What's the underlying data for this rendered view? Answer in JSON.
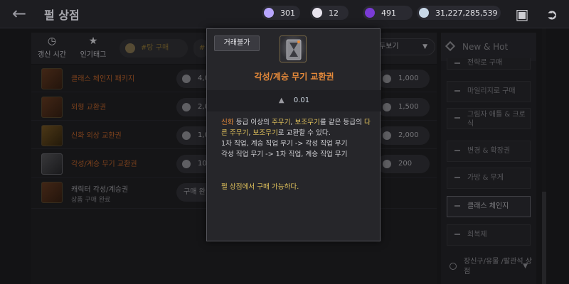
{
  "header": {
    "title": "펄 상점",
    "currencies": [
      {
        "icon": "purple-crystal-icon",
        "value": "301",
        "color": "#b8a6ff"
      },
      {
        "icon": "pearl-icon",
        "value": "12",
        "color": "#e8e4ee"
      },
      {
        "icon": "dark-orb-icon",
        "value": "491",
        "color": "#7a3bd6"
      },
      {
        "icon": "silver-coin-icon",
        "value": "31,227,285,539",
        "color": "#c8d8e8"
      }
    ]
  },
  "filters": {
    "tabs": [
      {
        "icon": "clock-icon",
        "label": "갱신 시간"
      },
      {
        "icon": "star-icon",
        "label": "인기태그"
      }
    ],
    "pill_label": "#탕 구매",
    "pill_prefix": "#",
    "dropdown_label": "두보기"
  },
  "items": [
    {
      "name": "클래스 체인지 패키지",
      "price1": "4,0",
      "price2": "1,000"
    },
    {
      "name": "외형 교환권",
      "price1": "2,0",
      "price2": "1,500"
    },
    {
      "name": "신화 외상 교환권",
      "price1": "1,0",
      "price2": "2,000"
    },
    {
      "name": "각성/계승 무기 교환권",
      "price1": "10",
      "price2": "200"
    },
    {
      "name": "캐릭터 각성/계승권",
      "sub": "상품 구매 완료",
      "buy": "구매 완"
    }
  ],
  "right_panel": {
    "header": "New & Hot",
    "items": [
      {
        "label": "전략로 구매"
      },
      {
        "label": "마일리지로 구매"
      },
      {
        "label": "그림자 애틀 & 크로식"
      },
      {
        "label": "변경 & 확장권"
      },
      {
        "label": "가방 & 무게"
      },
      {
        "label": "클래스 체인지"
      },
      {
        "label": "회복제"
      }
    ],
    "footer": "장신구/유물 /팔관석 상점"
  },
  "popup": {
    "badge": "거래불가",
    "title": "각성/계승 무기 교환권",
    "weight": "0.01",
    "desc": {
      "p1": "신화",
      "p2": " 등급 이상의 ",
      "p3": "주무기",
      "p4": ", ",
      "p5": "보조무기",
      "p6": "를 같은 등급의 ",
      "p7": "다른 주무기",
      "p8": ", ",
      "p9": "보조무기",
      "p10": "로 교환할 수 있다.",
      "line2": "1차 직업, 계승 직업 무기 -> 각성 직업 무기",
      "line3": "각성 직업 무기 -> 1차 직업, 계승 직업 무기"
    },
    "buy_note": "펄 상점에서 구매 가능하다."
  }
}
